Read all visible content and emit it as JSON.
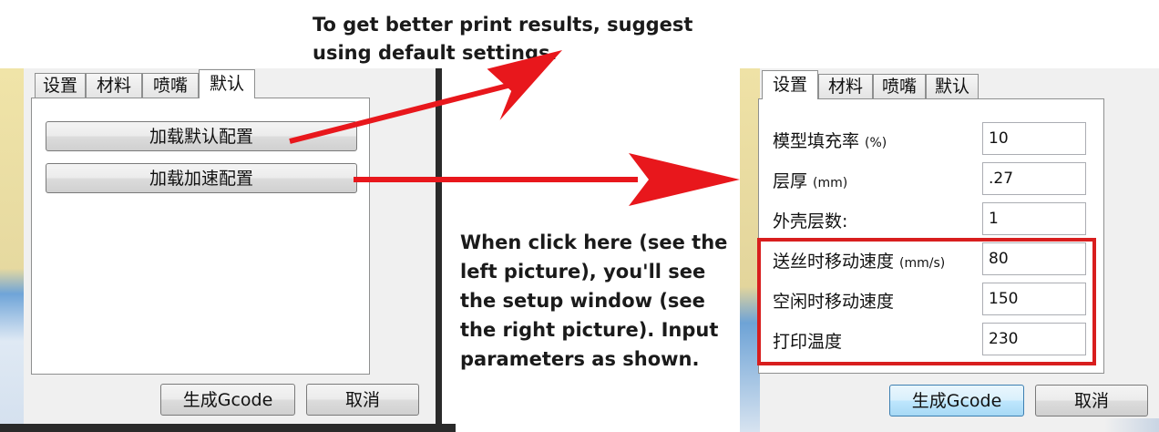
{
  "annotations": {
    "top_line1": "To get better print results, suggest",
    "top_line2": "using default settings.",
    "middle_lines": [
      "When click here (see the",
      "left picture), you'll see",
      "the setup window (see",
      "the right picture). Input",
      "parameters as shown."
    ],
    "arrow_color": "#e8171c",
    "highlight_box_color": "#d81e1e"
  },
  "left_dialog": {
    "tabs": [
      "设置",
      "材料",
      "喷嘴",
      "默认"
    ],
    "active_tab": "默认",
    "buttons": {
      "load_default": "加载默认配置",
      "load_speed": "加载加速配置"
    },
    "footer": {
      "generate": "生成Gcode",
      "cancel": "取消"
    }
  },
  "right_dialog": {
    "tabs": [
      "设置",
      "材料",
      "喷嘴",
      "默认"
    ],
    "active_tab": "设置",
    "fields": [
      {
        "label": "模型填充率",
        "unit": "(%)",
        "value": "10"
      },
      {
        "label": "层厚",
        "unit": "(mm)",
        "value": ".27"
      },
      {
        "label": "外壳层数:",
        "unit": "",
        "value": "1"
      },
      {
        "label": "送丝时移动速度",
        "unit": "(mm/s)",
        "value": "80"
      },
      {
        "label": "空闲时移动速度",
        "unit": "",
        "value": "150"
      },
      {
        "label": "打印温度",
        "unit": "",
        "value": "230"
      }
    ],
    "footer": {
      "generate": "生成Gcode",
      "cancel": "取消"
    }
  }
}
